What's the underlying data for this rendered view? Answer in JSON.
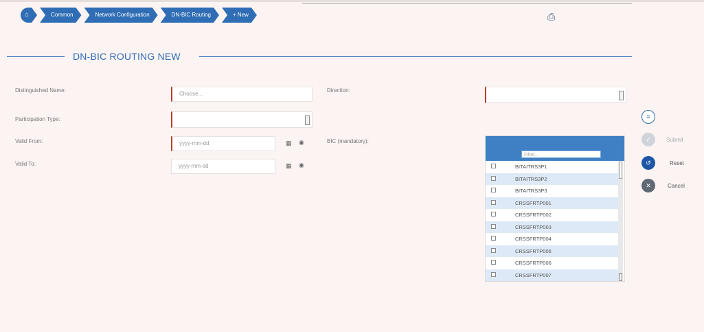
{
  "breadcrumb": {
    "items": [
      {
        "icon": "home-icon",
        "label": ""
      },
      {
        "label": "Common"
      },
      {
        "label": "Network Configuration"
      },
      {
        "label": "DN-BIC Routing"
      },
      {
        "label": "+ New"
      }
    ]
  },
  "page": {
    "title": "DN-BIC ROUTING NEW"
  },
  "form": {
    "distinguished_name": {
      "label": "Distinguished Name:",
      "placeholder": "Choose..."
    },
    "participation_type": {
      "label": "Participation Type:",
      "value": ""
    },
    "valid_from": {
      "label": "Valid From:",
      "placeholder": "yyyy-mm-dd"
    },
    "valid_to": {
      "label": "Valid To:",
      "placeholder": "yyyy-mm-dd"
    },
    "direction": {
      "label": "Direction:",
      "value": ""
    },
    "bic": {
      "label": "BIC (mandatory):",
      "filter_placeholder": "Filter...",
      "options": [
        "BITAITRS3P1",
        "BITAITRS3P2",
        "BITAITRS3P3",
        "CRSSFRTP001",
        "CRSSFRTP002",
        "CRSSFRTP003",
        "CRSSFRTP004",
        "CRSSFRTP005",
        "CRSSFRTP006",
        "CRSSFRTP007"
      ]
    }
  },
  "actions": {
    "submit": "Submit",
    "reset": "Reset",
    "cancel": "Cancel"
  }
}
